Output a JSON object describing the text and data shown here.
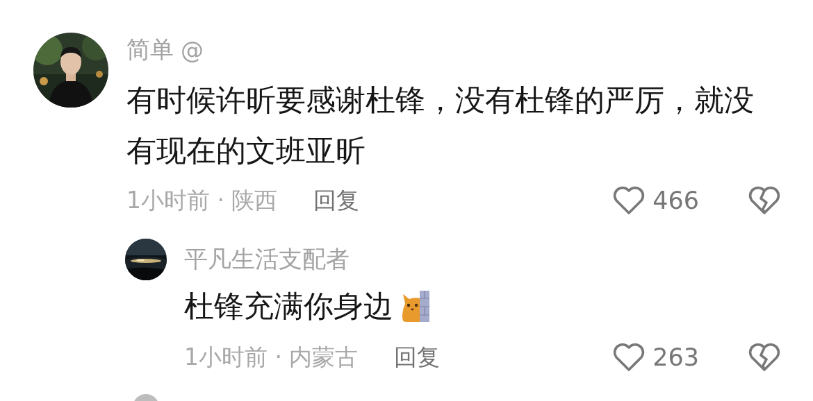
{
  "comments": [
    {
      "author": "简单",
      "mention": "@",
      "text": "有时候许昕要感谢杜锋，没有杜锋的严厉，就没有现在的文班亚昕",
      "time_location": "1小时前 · 陕西",
      "reply_label": "回复",
      "likes": "466",
      "replies": [
        {
          "author": "平凡生活支配者",
          "text": "杜锋充满你身边",
          "sticker": true,
          "time_location": "1小时前 · 内蒙古",
          "reply_label": "回复",
          "likes": "263"
        }
      ]
    }
  ]
}
